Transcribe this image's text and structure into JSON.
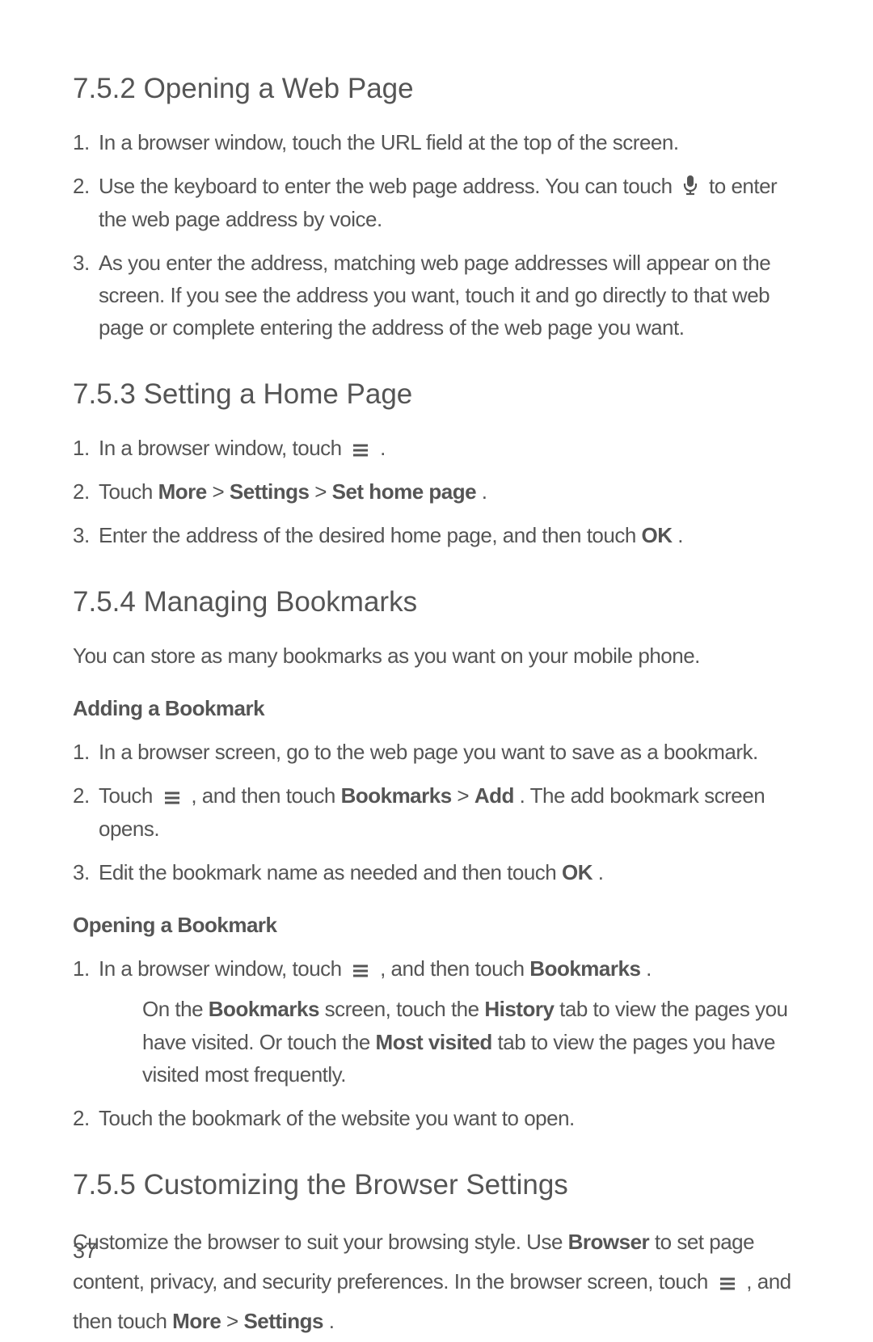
{
  "page_number": "37",
  "s752": {
    "heading": "7.5.2  Opening a Web Page",
    "items": {
      "i1": "In a browser window, touch the URL field at the top of the screen.",
      "i2a": "Use the keyboard to enter the web page address. You can touch ",
      "i2b": " to enter the web page address by voice.",
      "i3": "As you enter the address, matching web page addresses will appear on the screen. If you see the address you want, touch it and go directly to that web page or complete entering the address of the web page you want."
    }
  },
  "s753": {
    "heading": "7.5.3  Setting a Home Page",
    "items": {
      "i1a": "In a browser window, touch ",
      "i1b": " .",
      "i2a": "Touch ",
      "i2_more": "More",
      "i2_gt1": " > ",
      "i2_settings": "Settings",
      "i2_gt2": " > ",
      "i2_shp": "Set home page",
      "i2_end": ".",
      "i3a": "Enter the address of the desired home page, and then touch ",
      "i3_ok": "OK",
      "i3_end": "."
    }
  },
  "s754": {
    "heading": "7.5.4  Managing Bookmarks",
    "intro": "You can store as many bookmarks as you want on your mobile phone.",
    "sub_add": "Adding a Bookmark",
    "add_items": {
      "i1": "In a browser screen, go to the web page you want to save as a bookmark.",
      "i2a": "Touch ",
      "i2b": " , and then touch ",
      "i2_bm": "Bookmarks",
      "i2_gt": " > ",
      "i2_add": "Add",
      "i2_end": ". The add bookmark screen opens.",
      "i3a": "Edit the bookmark name as needed and then touch ",
      "i3_ok": "OK",
      "i3_end": "."
    },
    "sub_open": "Opening a Bookmark",
    "open_items": {
      "i1a": "In a browser window, touch ",
      "i1b": " , and then touch ",
      "i1_bm": "Bookmarks",
      "i1_end": ".",
      "note_a": "On the ",
      "note_bm": "Bookmarks",
      "note_b": " screen, touch the ",
      "note_hist": "History",
      "note_c": " tab to view the pages you have visited. Or touch the ",
      "note_mv": "Most visited",
      "note_d": " tab to view the pages you have visited most frequently.",
      "i2": "Touch the bookmark of the website you want to open."
    }
  },
  "s755": {
    "heading": "7.5.5  Customizing the Browser Settings",
    "p_a": "Customize the browser to suit your browsing style. Use ",
    "p_browser": "Browser",
    "p_b": " to set page content, privacy, and security preferences. In the browser screen, touch ",
    "p_c": " , and then touch ",
    "p_more": "More",
    "p_gt": " > ",
    "p_settings": "Settings",
    "p_end": "."
  }
}
